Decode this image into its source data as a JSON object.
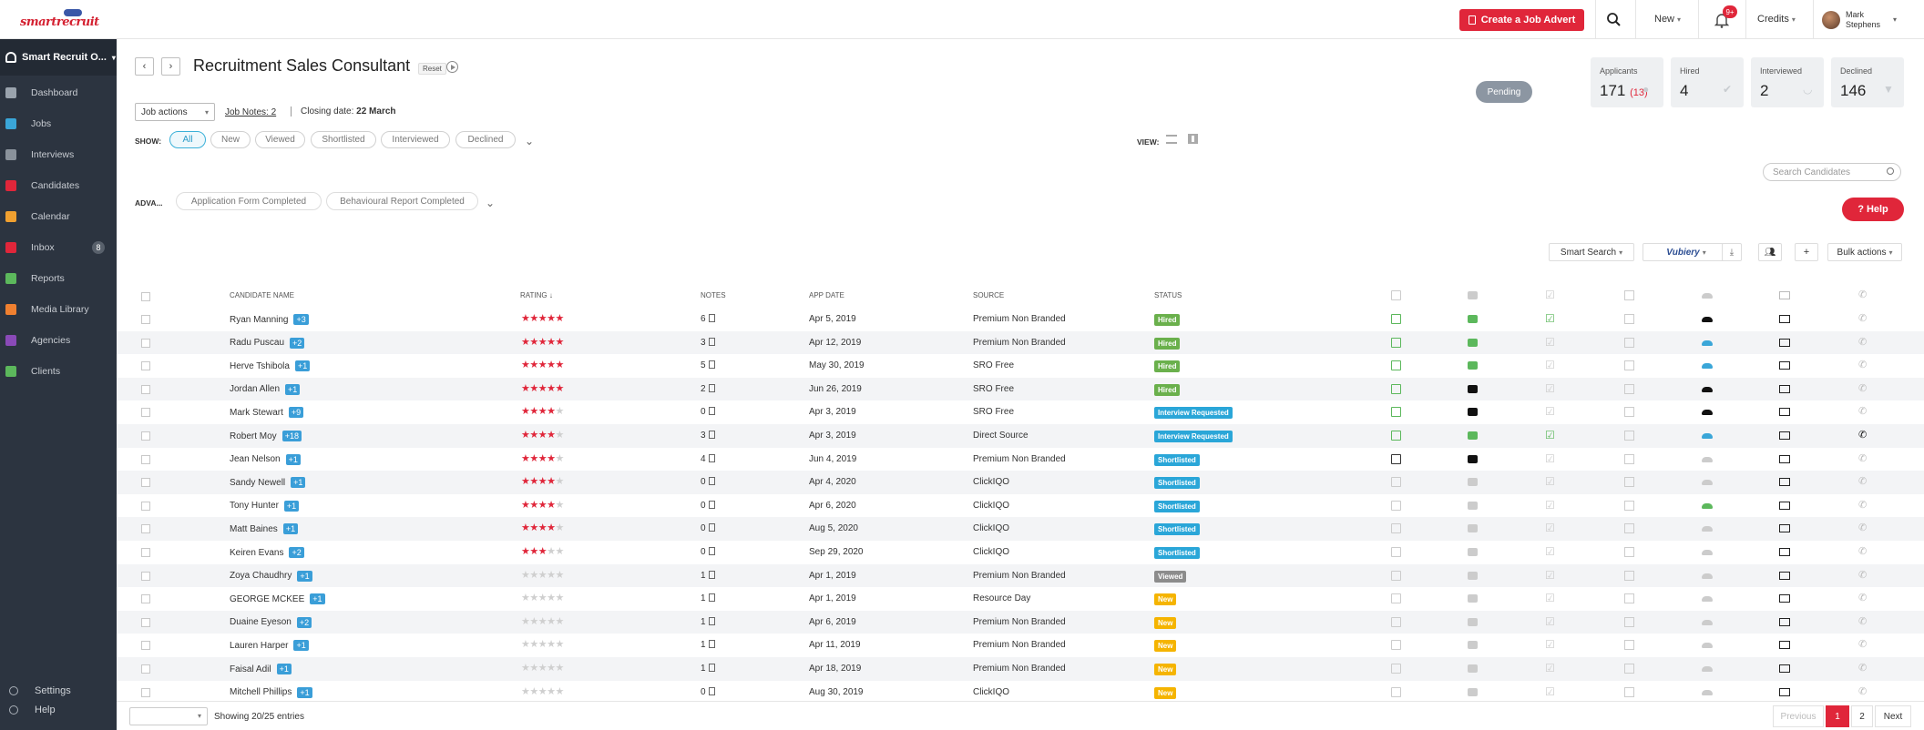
{
  "topbar": {
    "logo_text": "smartrecruit",
    "create_button": "Create a Job Advert",
    "new_label": "New",
    "notification_count": "9+",
    "credits_label": "Credits",
    "user_first": "Mark",
    "user_last": "Stephens"
  },
  "sidebar": {
    "org": "Smart Recruit O...",
    "items": [
      {
        "label": "Dashboard",
        "icon": "dashboard-icon",
        "color": "#9aa3ad"
      },
      {
        "label": "Jobs",
        "icon": "jobs-icon",
        "color": "#3aa6d8"
      },
      {
        "label": "Interviews",
        "icon": "interviews-icon",
        "color": "#8a929b"
      },
      {
        "label": "Candidates",
        "icon": "candidates-icon",
        "color": "#e0263a"
      },
      {
        "label": "Calendar",
        "icon": "calendar-icon",
        "color": "#f0a030"
      },
      {
        "label": "Inbox",
        "icon": "inbox-icon",
        "color": "#e0263a",
        "badge": "8"
      },
      {
        "label": "Reports",
        "icon": "reports-icon",
        "color": "#5cb85c"
      },
      {
        "label": "Media Library",
        "icon": "media-library-icon",
        "color": "#f08030"
      },
      {
        "label": "Agencies",
        "icon": "agencies-icon",
        "color": "#8a4ab8"
      },
      {
        "label": "Clients",
        "icon": "clients-icon",
        "color": "#5cb85c"
      }
    ],
    "settings": "Settings",
    "help": "Help"
  },
  "job": {
    "title": "Recruitment Sales Consultant",
    "reset": "Reset",
    "status": "Pending",
    "actions_label": "Job actions",
    "notes_label": "Job Notes: 2",
    "closing_label": "Closing date:",
    "closing_value": "22 March"
  },
  "stats": [
    {
      "label": "Applicants",
      "value": "171",
      "sub": "(13)",
      "icon": "person-icon"
    },
    {
      "label": "Hired",
      "value": "4",
      "sub": "",
      "icon": "check-icon"
    },
    {
      "label": "Interviewed",
      "value": "2",
      "sub": "",
      "icon": "handshake-icon"
    },
    {
      "label": "Declined",
      "value": "146",
      "sub": "",
      "icon": "thumbs-down-icon"
    }
  ],
  "filters": {
    "show_label": "SHOW:",
    "pills": [
      "All",
      "New",
      "Viewed",
      "Shortlisted",
      "Interviewed",
      "Declined"
    ],
    "active": "All",
    "view_label": "VIEW:",
    "search_placeholder": "Search Candidates",
    "help_label": "Help",
    "advanced_label": "ADVA...",
    "advanced": [
      "Application Form Completed",
      "Behavioural Report Completed"
    ]
  },
  "toolbar": {
    "smart_search": "Smart Search",
    "vubiery": "Vubiery",
    "bulk_actions": "Bulk actions"
  },
  "table": {
    "headers": {
      "name": "CANDIDATE NAME",
      "rating": "RATING",
      "notes": "NOTES",
      "date": "APP DATE",
      "source": "SOURCE",
      "status": "STATUS"
    },
    "status_colors": {
      "Hired": "#6ab04c",
      "Interview Requested": "#2aa6d8",
      "Shortlisted": "#2aa6d8",
      "Viewed": "#8c8c8c",
      "New": "#f5b400"
    },
    "rows": [
      {
        "name": "Ryan Manning",
        "plus": "+3",
        "rating": 5,
        "notes": "6",
        "date": "Apr 5, 2019",
        "source": "Premium Non Branded",
        "status": "Hired",
        "doc": "on",
        "vid": "on",
        "chk": "on",
        "hand": "dark",
        "phone": ""
      },
      {
        "name": "Radu Puscau",
        "plus": "+2",
        "rating": 5,
        "notes": "3",
        "date": "Apr 12, 2019",
        "source": "Premium Non Branded",
        "status": "Hired",
        "doc": "on",
        "vid": "on",
        "chk": "",
        "hand": "blue",
        "phone": ""
      },
      {
        "name": "Herve Tshibola",
        "plus": "+1",
        "rating": 5,
        "notes": "5",
        "date": "May 30, 2019",
        "source": "SRO Free",
        "status": "Hired",
        "doc": "on",
        "vid": "on",
        "chk": "",
        "hand": "blue",
        "phone": ""
      },
      {
        "name": "Jordan Allen",
        "plus": "+1",
        "rating": 5,
        "notes": "2",
        "date": "Jun 26, 2019",
        "source": "SRO Free",
        "status": "Hired",
        "doc": "on",
        "vid": "dark",
        "chk": "",
        "hand": "dark",
        "phone": ""
      },
      {
        "name": "Mark Stewart",
        "plus": "+9",
        "rating": 4,
        "notes": "0",
        "date": "Apr 3, 2019",
        "source": "SRO Free",
        "status": "Interview Requested",
        "doc": "on",
        "vid": "dark",
        "chk": "",
        "hand": "dark",
        "phone": ""
      },
      {
        "name": "Robert Moy",
        "plus": "+18",
        "rating": 4,
        "notes": "3",
        "date": "Apr 3, 2019",
        "source": "Direct Source",
        "status": "Interview Requested",
        "doc": "on",
        "vid": "on",
        "chk": "on",
        "hand": "blue",
        "phone": "on"
      },
      {
        "name": "Jean Nelson",
        "plus": "+1",
        "rating": 4,
        "notes": "4",
        "date": "Jun 4, 2019",
        "source": "Premium Non Branded",
        "status": "Shortlisted",
        "doc": "dark",
        "vid": "dark",
        "chk": "",
        "hand": "",
        "phone": ""
      },
      {
        "name": "Sandy Newell",
        "plus": "+1",
        "rating": 4,
        "notes": "0",
        "date": "Apr 4, 2020",
        "source": "ClickIQO",
        "status": "Shortlisted",
        "doc": "",
        "vid": "",
        "chk": "",
        "hand": "",
        "phone": ""
      },
      {
        "name": "Tony Hunter",
        "plus": "+1",
        "rating": 4,
        "notes": "0",
        "date": "Apr 6, 2020",
        "source": "ClickIQO",
        "status": "Shortlisted",
        "doc": "",
        "vid": "",
        "chk": "",
        "hand": "green",
        "phone": ""
      },
      {
        "name": "Matt Baines",
        "plus": "+1",
        "rating": 4,
        "notes": "0",
        "date": "Aug 5, 2020",
        "source": "ClickIQO",
        "status": "Shortlisted",
        "doc": "",
        "vid": "",
        "chk": "",
        "hand": "",
        "phone": ""
      },
      {
        "name": "Keiren Evans",
        "plus": "+2",
        "rating": 3,
        "notes": "0",
        "date": "Sep 29, 2020",
        "source": "ClickIQO",
        "status": "Shortlisted",
        "doc": "",
        "vid": "",
        "chk": "",
        "hand": "",
        "phone": ""
      },
      {
        "name": "Zoya Chaudhry",
        "plus": "+1",
        "rating": 0,
        "notes": "1",
        "date": "Apr 1, 2019",
        "source": "Premium Non Branded",
        "status": "Viewed",
        "doc": "",
        "vid": "",
        "chk": "",
        "hand": "",
        "phone": ""
      },
      {
        "name": "GEORGE MCKEE",
        "plus": "+1",
        "rating": 0,
        "notes": "1",
        "date": "Apr 1, 2019",
        "source": "Resource Day",
        "status": "New",
        "doc": "",
        "vid": "",
        "chk": "",
        "hand": "",
        "phone": ""
      },
      {
        "name": "Duaine Eyeson",
        "plus": "+2",
        "rating": 0,
        "notes": "1",
        "date": "Apr 6, 2019",
        "source": "Premium Non Branded",
        "status": "New",
        "doc": "",
        "vid": "",
        "chk": "",
        "hand": "",
        "phone": ""
      },
      {
        "name": "Lauren Harper",
        "plus": "+1",
        "rating": 0,
        "notes": "1",
        "date": "Apr 11, 2019",
        "source": "Premium Non Branded",
        "status": "New",
        "doc": "",
        "vid": "",
        "chk": "",
        "hand": "",
        "phone": ""
      },
      {
        "name": "Faisal Adil",
        "plus": "+1",
        "rating": 0,
        "notes": "1",
        "date": "Apr 18, 2019",
        "source": "Premium Non Branded",
        "status": "New",
        "doc": "",
        "vid": "",
        "chk": "",
        "hand": "",
        "phone": ""
      },
      {
        "name": "Mitchell Phillips",
        "plus": "+1",
        "rating": 0,
        "notes": "0",
        "date": "Aug 30, 2019",
        "source": "ClickIQO",
        "status": "New",
        "doc": "",
        "vid": "",
        "chk": "",
        "hand": "",
        "phone": ""
      }
    ]
  },
  "footer": {
    "showing": "Showing 20/25 entries",
    "previous": "Previous",
    "pages": [
      "1",
      "2"
    ],
    "active_page": "1",
    "next": "Next"
  }
}
